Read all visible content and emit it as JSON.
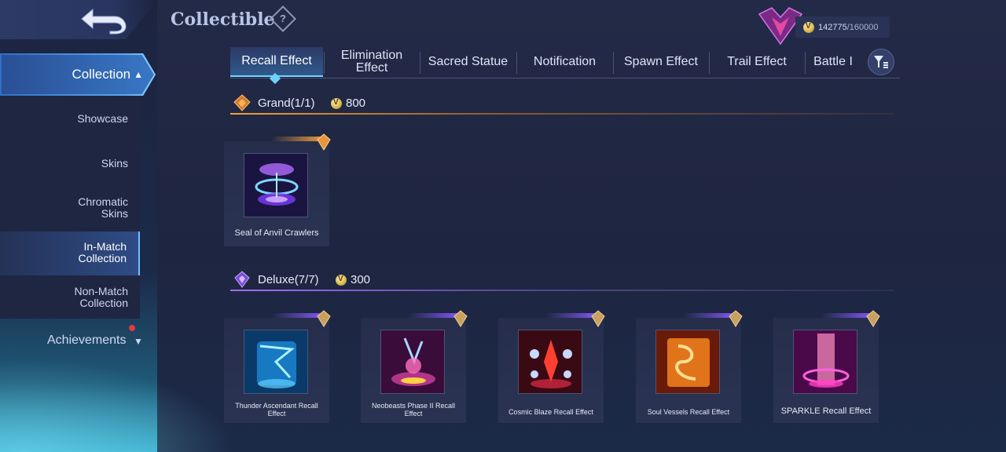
{
  "header": {
    "title": "Collectible",
    "help_symbol": "?"
  },
  "currency": {
    "current": "142775",
    "max": "/160000"
  },
  "sidebar": {
    "collection_label": "Collection",
    "items": [
      {
        "label": "Showcase"
      },
      {
        "label": "Skins"
      },
      {
        "label": "Chromatic Skins"
      },
      {
        "label": "In-Match Collection"
      },
      {
        "label": "Non-Match Collection"
      }
    ],
    "achievements_label": "Achievements"
  },
  "tabs": [
    {
      "label": "Recall Effect"
    },
    {
      "label": "Elimination Effect"
    },
    {
      "label": "Sacred Statue"
    },
    {
      "label": "Notification"
    },
    {
      "label": "Spawn Effect"
    },
    {
      "label": "Trail Effect"
    },
    {
      "label": "Battle I"
    }
  ],
  "sections": {
    "grand": {
      "title": "Grand(1/1)",
      "cost": "800",
      "items": [
        {
          "name": "Seal of Anvil Crawlers"
        }
      ]
    },
    "deluxe": {
      "title": "Deluxe(7/7)",
      "cost": "300",
      "items": [
        {
          "name": "Thunder Ascendant Recall Effect"
        },
        {
          "name": "Neobeasts Phase II Recall Effect"
        },
        {
          "name": "Cosmic Blaze Recall Effect"
        },
        {
          "name": "Soul Vessels Recall Effect"
        },
        {
          "name": "SPARKLE Recall Effect"
        }
      ]
    }
  },
  "colors": {
    "grand_accent": "#f0a040",
    "deluxe_accent": "#a070ff",
    "active_tab": "#6fd3ff"
  }
}
